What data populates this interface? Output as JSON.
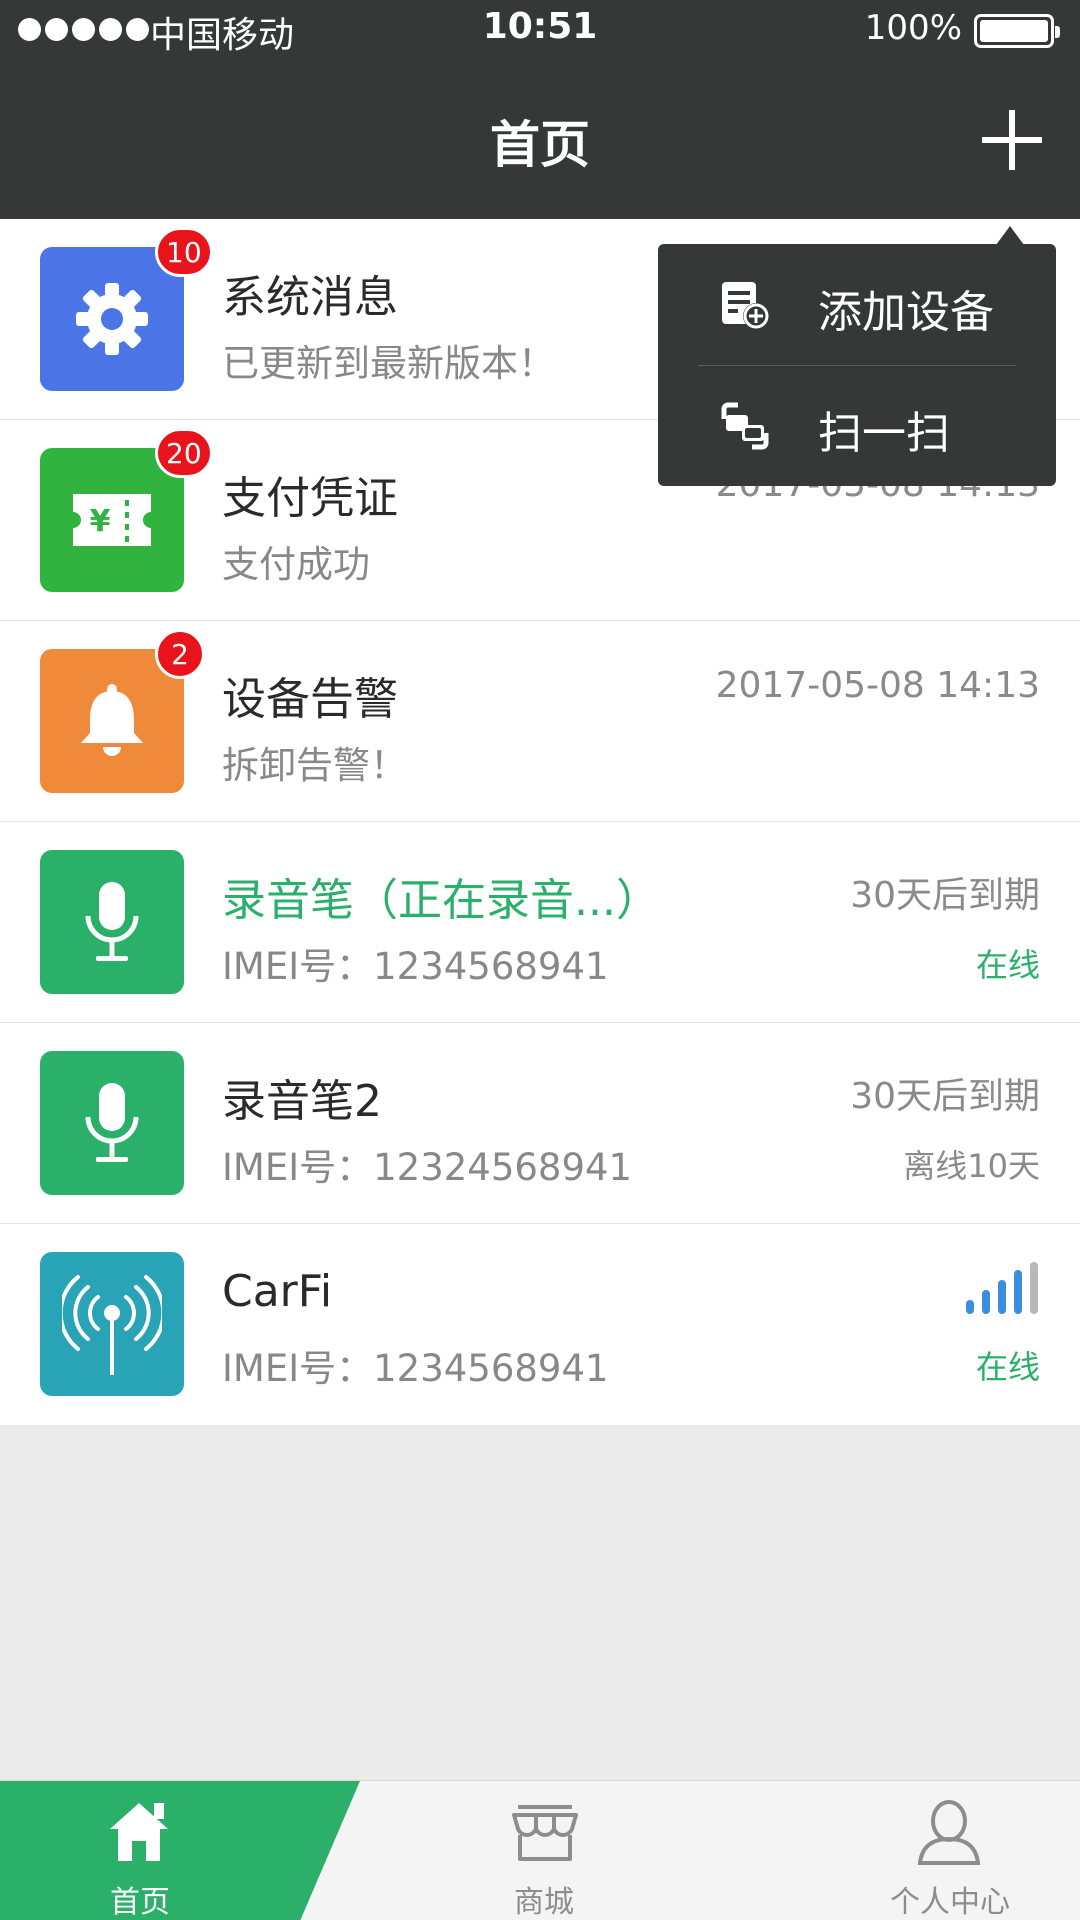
{
  "status_bar": {
    "carrier": "中国移动",
    "time": "10:51",
    "battery": "100%"
  },
  "header": {
    "title": "首页"
  },
  "menu": {
    "items": [
      {
        "label": "添加设备",
        "icon": "add-device-icon"
      },
      {
        "label": "扫一扫",
        "icon": "scan-icon"
      }
    ]
  },
  "list": [
    {
      "title": "系统消息",
      "subtitle": "已更新到最新版本！",
      "badge": "10",
      "icon": "gear-icon",
      "color": "#4b74e6"
    },
    {
      "title": "支付凭证",
      "subtitle": "支付成功",
      "badge": "20",
      "time": "2017-05-08 14:13",
      "icon": "ticket-icon",
      "color": "#31b33f"
    },
    {
      "title": "设备告警",
      "subtitle": "拆卸告警！",
      "badge": "2",
      "time": "2017-05-08  14:13",
      "icon": "bell-icon",
      "color": "#ef8a3a"
    },
    {
      "title": "录音笔（正在录音...）",
      "subtitle": "IMEI号：1234568941",
      "right_top": "30天后到期",
      "right_bottom": "在线",
      "icon": "microphone-icon",
      "color": "#2bb06a"
    },
    {
      "title": "录音笔2",
      "subtitle": "IMEI号：12324568941",
      "right_top": "30天后到期",
      "right_bottom": "离线10天",
      "icon": "microphone-icon",
      "color": "#2bb06a"
    },
    {
      "title": "CarFi",
      "subtitle": "IMEI号：1234568941",
      "right_bottom": "在线",
      "signal_level": 4,
      "icon": "antenna-icon",
      "color": "#29a3b6"
    }
  ],
  "tabs": [
    {
      "label": "首页",
      "icon": "home-icon",
      "active": true
    },
    {
      "label": "商城",
      "icon": "store-icon",
      "active": false
    },
    {
      "label": "个人中心",
      "icon": "user-icon",
      "active": false
    }
  ],
  "colors": {
    "header_bg": "#363838",
    "accent_green": "#2bb06a",
    "badge_red": "#e8131b",
    "signal_blue": "#3b8de0"
  }
}
